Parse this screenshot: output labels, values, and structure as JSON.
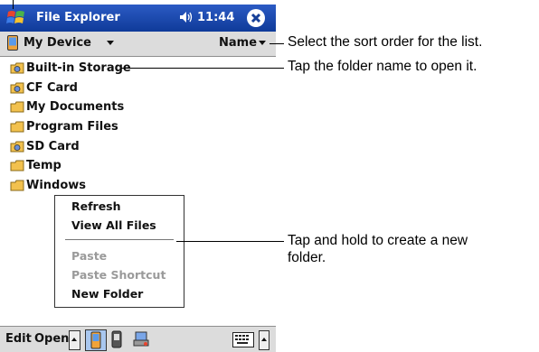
{
  "titlebar": {
    "title": "File Explorer",
    "time": "11:44",
    "volume_glyph": "◀€",
    "close_glyph": "✕"
  },
  "navbar": {
    "location": "My Device",
    "sort": "Name"
  },
  "folders": [
    {
      "name": "Built-in Storage",
      "icon": "storage-card-icon"
    },
    {
      "name": "CF Card",
      "icon": "storage-card-icon"
    },
    {
      "name": "My Documents",
      "icon": "folder-icon"
    },
    {
      "name": "Program Files",
      "icon": "folder-icon"
    },
    {
      "name": "SD Card",
      "icon": "storage-card-icon"
    },
    {
      "name": "Temp",
      "icon": "folder-icon"
    },
    {
      "name": "Windows",
      "icon": "folder-icon"
    }
  ],
  "context_menu": {
    "refresh": "Refresh",
    "view_all": "View All Files",
    "paste": "Paste",
    "paste_shortcut": "Paste Shortcut",
    "new_folder": "New Folder"
  },
  "menubar": {
    "edit": "Edit",
    "open": "Open"
  },
  "callouts": {
    "sort": "Select the sort order for the list.",
    "open_folder": "Tap the folder name to open it.",
    "new_folder": "Tap and hold to create a new folder."
  },
  "colors": {
    "titlebar": "#1f4db3",
    "bars": "#dcdcdc",
    "folder": "#f2c14e"
  }
}
